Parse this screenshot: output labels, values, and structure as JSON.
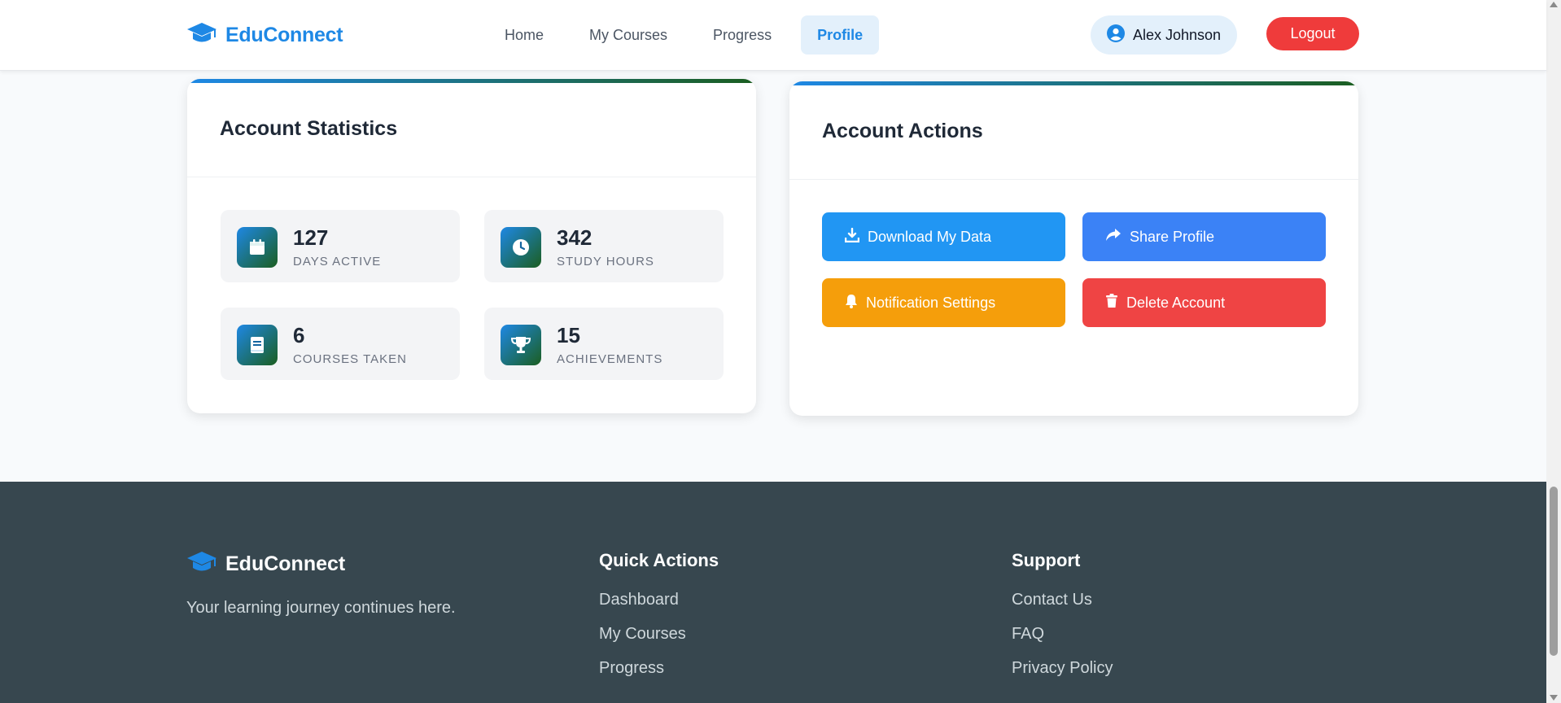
{
  "header": {
    "brand": "EduConnect",
    "nav": [
      {
        "label": "Home",
        "active": false
      },
      {
        "label": "My Courses",
        "active": false
      },
      {
        "label": "Progress",
        "active": false
      },
      {
        "label": "Profile",
        "active": true
      }
    ],
    "user_name": "Alex Johnson",
    "logout_label": "Logout"
  },
  "stats_card": {
    "title": "Account Statistics",
    "stats": [
      {
        "value": "127",
        "label": "Days Active",
        "icon": "calendar-icon"
      },
      {
        "value": "342",
        "label": "Study Hours",
        "icon": "clock-icon"
      },
      {
        "value": "6",
        "label": "Courses Taken",
        "icon": "book-icon"
      },
      {
        "value": "15",
        "label": "Achievements",
        "icon": "trophy-icon"
      }
    ]
  },
  "actions_card": {
    "title": "Account Actions",
    "actions": [
      {
        "label": "Download My Data",
        "icon": "download-icon",
        "color": "#2196f3"
      },
      {
        "label": "Share Profile",
        "icon": "share-icon",
        "color": "#3b82f6"
      },
      {
        "label": "Notification Settings",
        "icon": "bell-icon",
        "color": "#f59e0b"
      },
      {
        "label": "Delete Account",
        "icon": "trash-icon",
        "color": "#ef4444"
      }
    ]
  },
  "footer": {
    "brand": "EduConnect",
    "tagline": "Your learning journey continues here.",
    "quick_actions": {
      "heading": "Quick Actions",
      "links": [
        "Dashboard",
        "My Courses",
        "Progress"
      ]
    },
    "support": {
      "heading": "Support",
      "links": [
        "Contact Us",
        "FAQ",
        "Privacy Policy"
      ]
    }
  },
  "colors": {
    "primary": "#1e88e5",
    "danger": "#ef3b3b",
    "footer_bg": "#37474f"
  }
}
